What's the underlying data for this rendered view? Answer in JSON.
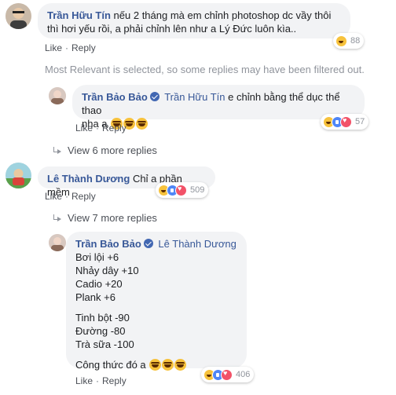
{
  "thread": {
    "c1": {
      "author": "Trần Hữu Tín",
      "text": "nếu 2 tháng mà em chỉnh photoshop dc vầy thôi thì hơi yếu rồi, a phải chỉnh lên như a Lý Đức luôn kìa..",
      "reaction_count": "88",
      "like_label": "Like",
      "reply_label": "Reply"
    },
    "filter_note": "Most Relevant is selected, so some replies may have been filtered out.",
    "r1": {
      "author": "Trần Bảo Bảo",
      "mention": "Trần Hữu Tín",
      "text_line1": "e chỉnh bằng thể dục thể thao",
      "text_line2": "nha a",
      "reaction_count": "57",
      "like_label": "Like",
      "reply_label": "Reply"
    },
    "view_more_1": "View 6 more replies",
    "c2": {
      "author": "Lê Thành Dương",
      "text": "Chỉ a phần mềm",
      "reaction_count": "509",
      "like_label": "Like",
      "reply_label": "Reply"
    },
    "view_more_2": "View 7 more replies",
    "r2": {
      "author": "Trần Bảo Bảo",
      "mention": "Lê Thành Dương",
      "lines": [
        "Bơi lội +6",
        "Nhảy dây +10",
        "Cadio +20",
        "Plank +6",
        "",
        "Tinh bột -90",
        "Đường -80",
        "Trà sữa -100",
        "",
        "Công thức đó a"
      ],
      "reaction_count": "406",
      "like_label": "Like",
      "reply_label": "Reply"
    }
  },
  "colors": {
    "name": "#385898",
    "bubble": "#f2f3f5",
    "muted": "#90949c"
  },
  "icons": [
    "haha-emoji-icon",
    "like-reaction-icon",
    "love-reaction-icon",
    "verified-badge-icon",
    "reply-arrow-icon"
  ]
}
